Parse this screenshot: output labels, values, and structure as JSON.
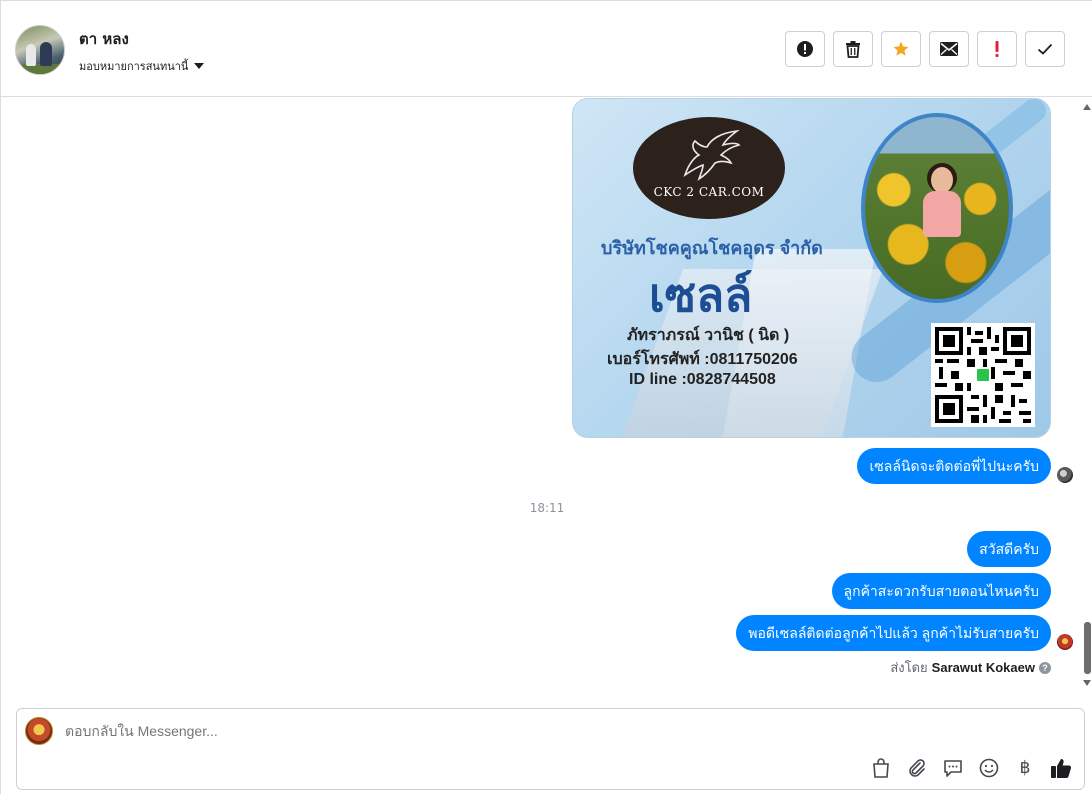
{
  "header": {
    "contact_name": "ตา หลง",
    "assign_label": "มอบหมายการสนทนานี้",
    "actions": [
      {
        "icon": "exclamation-circle-icon"
      },
      {
        "icon": "trash-icon"
      },
      {
        "icon": "star-icon",
        "color": "#f5a623"
      },
      {
        "icon": "envelope-icon"
      },
      {
        "icon": "exclamation-icon",
        "color": "#e41e3f"
      },
      {
        "icon": "check-icon"
      }
    ]
  },
  "card": {
    "logo_text": "CKC 2 CAR.COM",
    "company": "บริษัทโชคคูณโชคอุดร จำกัด",
    "role": "เซลล์",
    "person_name": "ภัทราภรณ์  วานิช ( นิด )",
    "phone": "เบอร์โทรศัพท์ :0811750206",
    "line_id": "ID line :0828744508"
  },
  "messages": [
    {
      "text": "เซลล์นิดจะติดต่อพี่ไปนะครับ"
    },
    {
      "text": "สวัสดีครับ"
    },
    {
      "text": "ลูกค้าสะดวกรับสายตอนไหนครับ"
    },
    {
      "text": "พอดีเซลล์ติดต่อลูกค้าไปแล้ว ลูกค้าไม่รับสายครับ"
    }
  ],
  "timestamp": "18:11",
  "sent_by": {
    "prefix": "ส่งโดย",
    "name": "Sarawut Kokaew"
  },
  "composer": {
    "placeholder": "ตอบกลับใน Messenger...",
    "tools": [
      "bag-icon",
      "paperclip-icon",
      "quick-reply-icon",
      "emoji-icon",
      "baht-icon",
      "thumbs-up-icon"
    ],
    "baht_symbol": "฿"
  },
  "colors": {
    "bubble": "#0084ff",
    "accent_star": "#f5a623",
    "accent_red": "#e41e3f"
  }
}
